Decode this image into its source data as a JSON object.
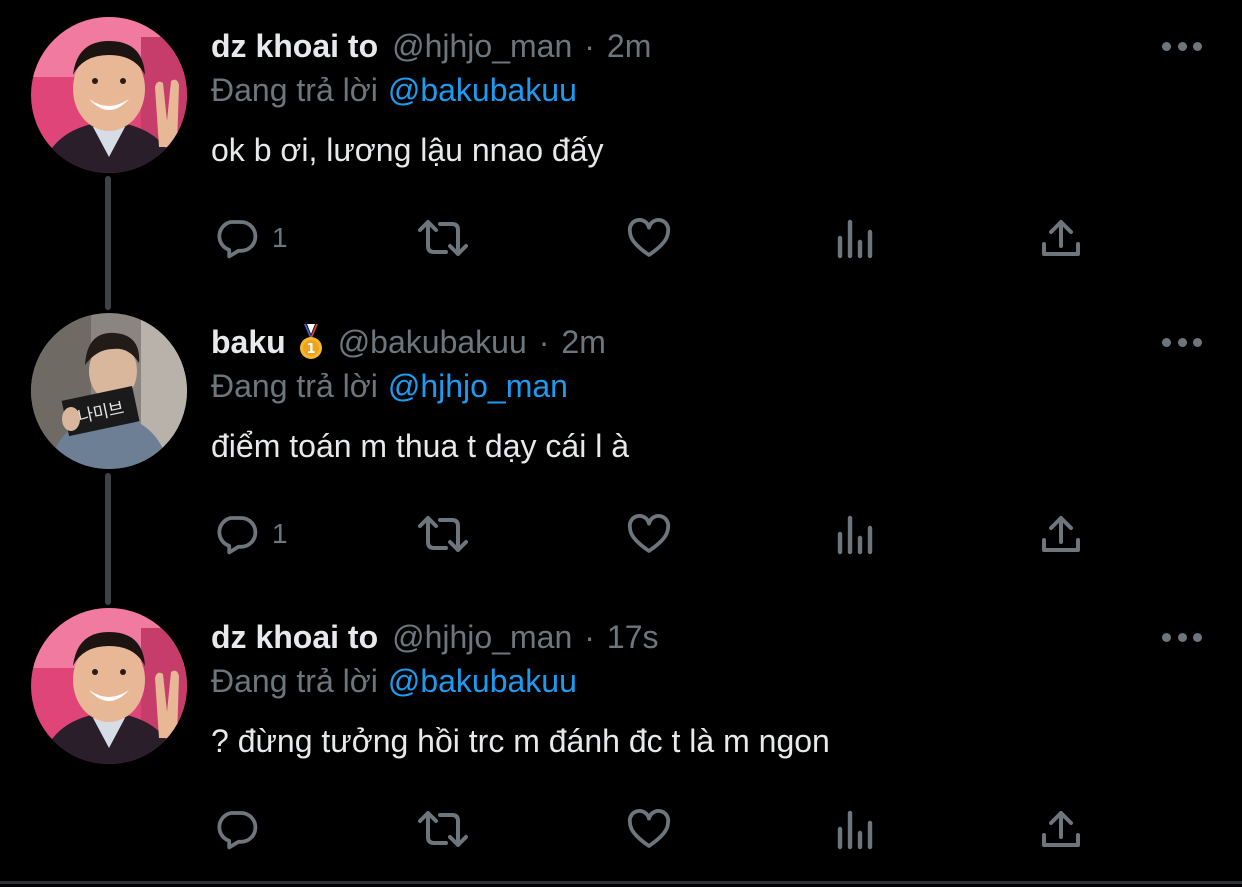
{
  "tweets": [
    {
      "name": "dz khoai to",
      "handle": "@hjhjo_man",
      "separator": "·",
      "time": "2m",
      "replying_label": "Đang trả lời",
      "replying_to": "@bakubakuu",
      "text": "ok b ơi, lương lậu nnao đấy",
      "reply_count": "1",
      "avatar": "man-smiling-peace-sign",
      "has_badge": false
    },
    {
      "name": "baku",
      "handle": "@bakubakuu",
      "separator": "·",
      "time": "2m",
      "replying_label": "Đang trả lời",
      "replying_to": "@hjhjo_man",
      "text": "điểm toán m thua t dạy cái l à",
      "reply_count": "1",
      "avatar": "young-man-holding-sign",
      "avatar_sign_text": "나미브",
      "has_badge": true,
      "badge_icon": "gold-medal-icon",
      "badge_digit": "1"
    },
    {
      "name": "dz khoai to",
      "handle": "@hjhjo_man",
      "separator": "·",
      "time": "17s",
      "replying_label": "Đang trả lời",
      "replying_to": "@bakubakuu",
      "text": "? đừng tưởng hồi trc m đánh đc t là m ngon",
      "reply_count": "",
      "avatar": "man-smiling-peace-sign",
      "has_badge": false
    }
  ],
  "icons": {
    "reply": "reply-icon",
    "retweet": "retweet-icon",
    "like": "heart-icon",
    "views": "views-icon",
    "share": "share-icon",
    "more": "more-dots-icon"
  },
  "colors": {
    "background": "#000000",
    "text": "#e7e9ea",
    "muted": "#6e767d",
    "link": "#1d9bf0",
    "thread_line": "#3d4247"
  }
}
